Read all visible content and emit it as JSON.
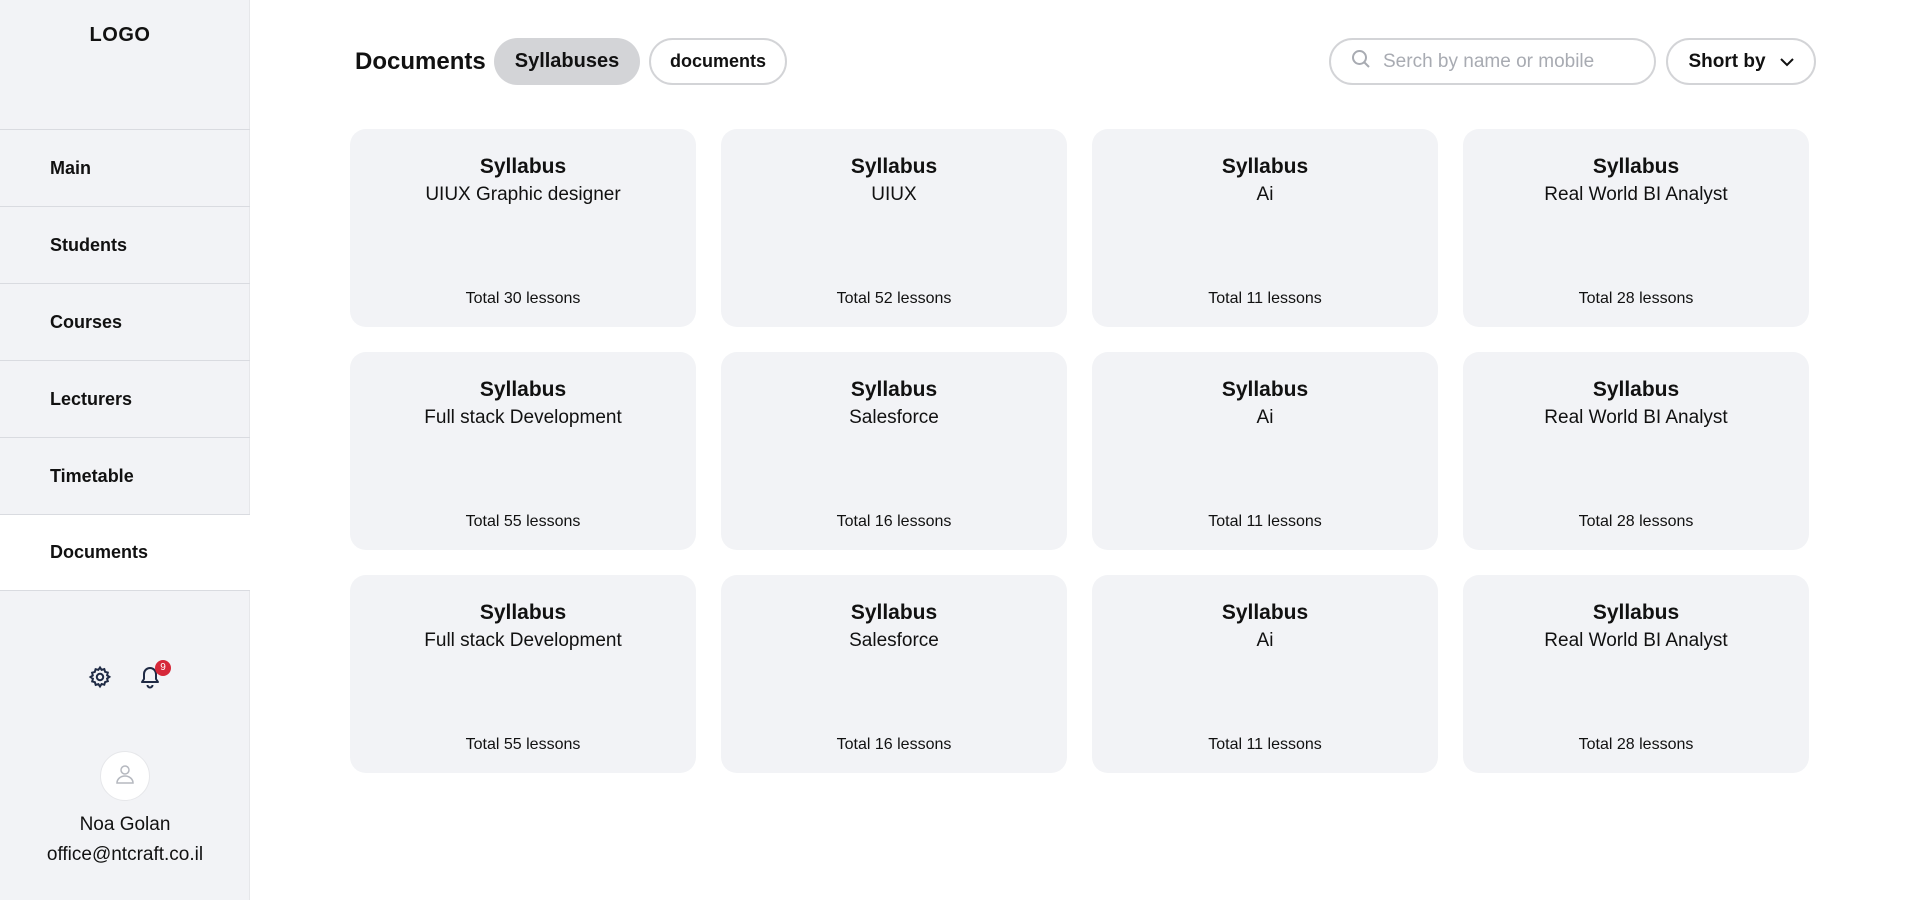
{
  "sidebar": {
    "logo": "LOGO",
    "nav": [
      {
        "label": "Main"
      },
      {
        "label": "Students"
      },
      {
        "label": "Courses"
      },
      {
        "label": "Lecturers"
      },
      {
        "label": "Timetable"
      },
      {
        "label": "Documents"
      }
    ],
    "active_nav": "Documents",
    "icons": {
      "settings": "gear-icon",
      "notifications": "bell-icon"
    },
    "notification_count": "9",
    "user": {
      "name": "Noa Golan",
      "email": "office@ntcraft.co.il"
    }
  },
  "header": {
    "title": "Documents",
    "tabs": [
      {
        "label": "Syllabuses",
        "selected": true
      },
      {
        "label": "documents",
        "selected": false
      }
    ],
    "search": {
      "placeholder": "Serch by name or mobile",
      "value": ""
    },
    "sort_label": "Short by"
  },
  "cards": [
    {
      "title": "Syllabus",
      "subtitle": "UIUX Graphic designer",
      "footer": "Total 30 lessons"
    },
    {
      "title": "Syllabus",
      "subtitle": "UIUX",
      "footer": "Total 52 lessons"
    },
    {
      "title": "Syllabus",
      "subtitle": "Ai",
      "footer": "Total 11 lessons"
    },
    {
      "title": "Syllabus",
      "subtitle": "Real World BI Analyst",
      "footer": "Total 28 lessons"
    },
    {
      "title": "Syllabus",
      "subtitle": "Full stack Development",
      "footer": "Total 55 lessons"
    },
    {
      "title": "Syllabus",
      "subtitle": "Salesforce",
      "footer": "Total 16 lessons"
    },
    {
      "title": "Syllabus",
      "subtitle": "Ai",
      "footer": "Total 11 lessons"
    },
    {
      "title": "Syllabus",
      "subtitle": "Real World BI Analyst",
      "footer": "Total 28 lessons"
    },
    {
      "title": "Syllabus",
      "subtitle": "Full stack Development",
      "footer": "Total 55 lessons"
    },
    {
      "title": "Syllabus",
      "subtitle": "Salesforce",
      "footer": "Total 16 lessons"
    },
    {
      "title": "Syllabus",
      "subtitle": "Ai",
      "footer": "Total 11 lessons"
    },
    {
      "title": "Syllabus",
      "subtitle": "Real World BI Analyst",
      "footer": "Total 28 lessons"
    }
  ],
  "colors": {
    "sidebar_bg": "#f2f3f6",
    "card_bg": "#f2f3f6",
    "tab_selected_bg": "#d3d4d7",
    "badge": "#d62839",
    "icon": "#1f2a44"
  }
}
